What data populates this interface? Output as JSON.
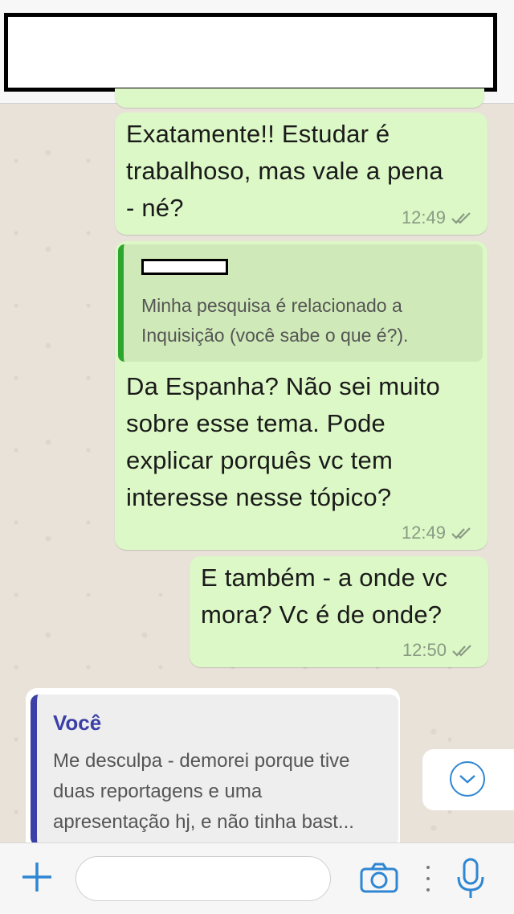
{
  "header": {
    "title": ""
  },
  "messages": [
    {
      "id": "m1",
      "text_lines": [
        "Exatamente!! Estudar é",
        "trabalhoso, mas vale a pena",
        "- né?"
      ],
      "time": "12:49",
      "status": "read"
    },
    {
      "id": "m2",
      "quote": {
        "author": "",
        "text_lines": [
          "Minha pesquisa é relacionado a",
          "Inquisição (você sabe o que é?)."
        ]
      },
      "text_lines": [
        "Da Espanha? Não sei muito",
        "sobre esse tema. Pode",
        "explicar porquês vc tem",
        "interesse nesse tópico?"
      ],
      "time": "12:49",
      "status": "read"
    },
    {
      "id": "m3",
      "text_lines": [
        "E também - a onde vc",
        "mora? Vc é de onde?"
      ],
      "time": "12:50",
      "status": "read"
    }
  ],
  "reply_preview": {
    "name": "Você",
    "text_lines": [
      "Me desculpa - demorei porque tive",
      "duas reportagens e uma",
      "apresentação hj, e não tinha bast..."
    ]
  },
  "input": {
    "placeholder": "",
    "value": ""
  },
  "colors": {
    "bubble_out": "#dcf8c6",
    "accent": "#2f86d3",
    "reply_bar": "#3b3fa6",
    "quote_bar": "#2ea52e"
  },
  "icons": [
    "plus-icon",
    "camera-icon",
    "more-dots-icon",
    "microphone-icon",
    "scroll-down-chevron-icon",
    "double-check-icon"
  ]
}
